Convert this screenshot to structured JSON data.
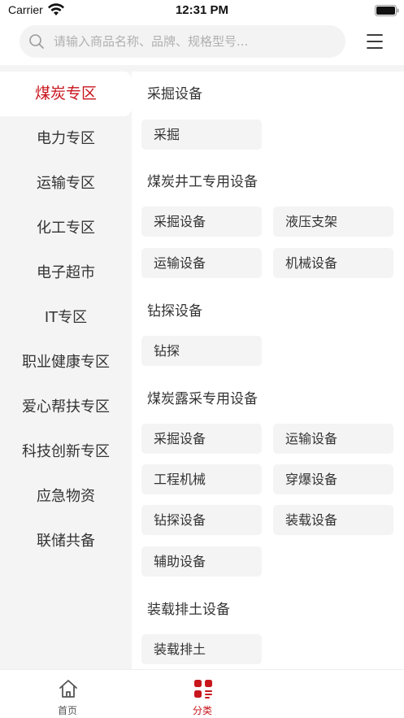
{
  "status_bar": {
    "carrier": "Carrier",
    "time": "12:31 PM"
  },
  "search": {
    "placeholder": "请输入商品名称、品牌、规格型号..."
  },
  "colors": {
    "accent": "#c8161d",
    "sidebar_bg": "#f4f4f4",
    "chip_bg": "#f4f4f4"
  },
  "icons": [
    "wifi-icon",
    "battery-icon",
    "search-icon",
    "menu-icon",
    "home-icon",
    "category-icon"
  ],
  "sidebar": {
    "active_index": 0,
    "items": [
      {
        "label": "煤炭专区"
      },
      {
        "label": "电力专区"
      },
      {
        "label": "运输专区"
      },
      {
        "label": "化工专区"
      },
      {
        "label": "电子超市"
      },
      {
        "label": "IT专区"
      },
      {
        "label": "职业健康专区"
      },
      {
        "label": "爱心帮扶专区"
      },
      {
        "label": "科技创新专区"
      },
      {
        "label": "应急物资"
      },
      {
        "label": "联储共备"
      }
    ]
  },
  "sections": [
    {
      "title": "采掘设备",
      "items": [
        "采掘"
      ]
    },
    {
      "title": "煤炭井工专用设备",
      "items": [
        "采掘设备",
        "液压支架",
        "运输设备",
        "机械设备"
      ]
    },
    {
      "title": "钻探设备",
      "items": [
        "钻探"
      ]
    },
    {
      "title": "煤炭露采专用设备",
      "items": [
        "采掘设备",
        "运输设备",
        "工程机械",
        "穿爆设备",
        "钻探设备",
        "装载设备",
        "辅助设备"
      ]
    },
    {
      "title": "装载排土设备",
      "items": [
        "装载排土"
      ]
    }
  ],
  "tabbar": {
    "tabs": [
      {
        "label": "首页",
        "active": false
      },
      {
        "label": "分类",
        "active": true
      }
    ]
  }
}
